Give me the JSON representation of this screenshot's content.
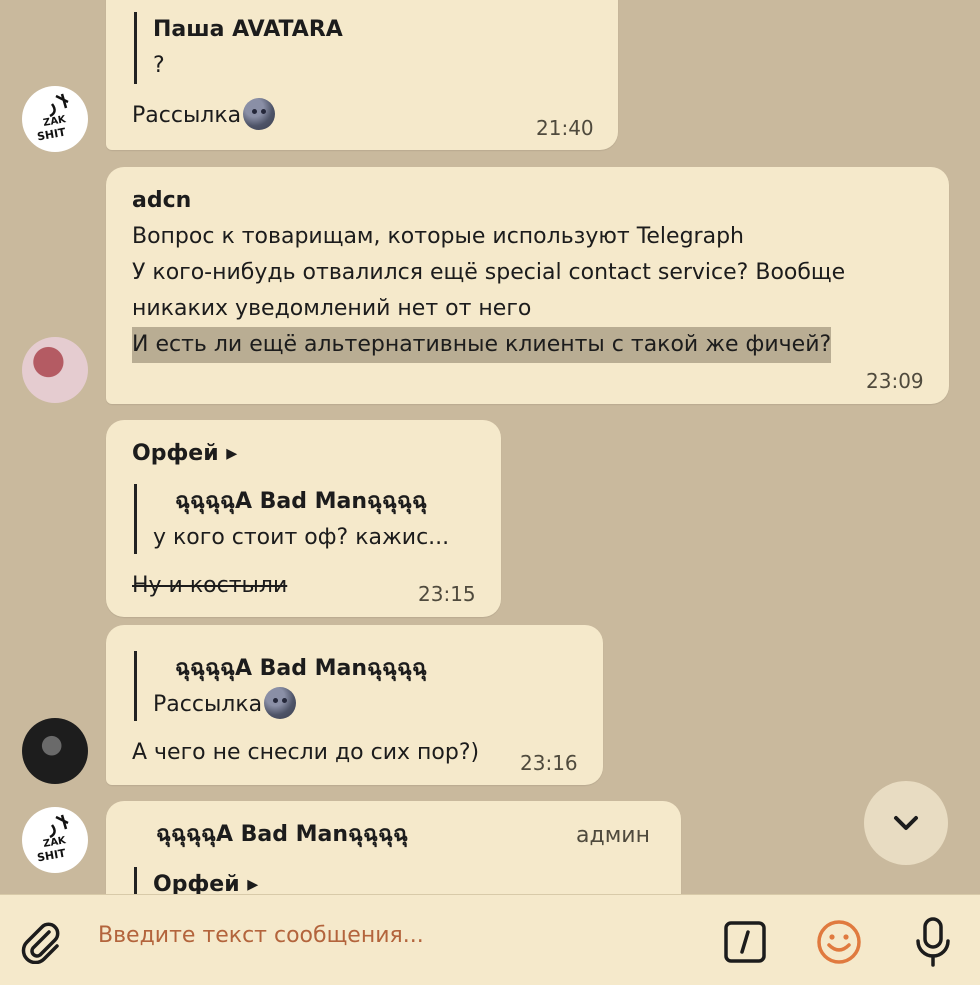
{
  "messages": [
    {
      "quote": {
        "name": "Паша AVATARA",
        "text": "?"
      },
      "text": "Рассылка",
      "emoji": "new-moon-face-emoji",
      "time": "21:40"
    },
    {
      "sender": "adcn",
      "lines": [
        "Вопрос к товарищам, которые используют Telegraph",
        "У кого-нибудь отвалился ещё special contact service? Вообще",
        "никаких уведомлений нет от него",
        "И есть ли ещё альтернативные клиенты с такой же фичей?"
      ],
      "time": "23:09"
    },
    {
      "sender": "Орфей ▸",
      "quote": {
        "name": "ฉุฉุฉุฉุA Bad Manฉุฉุฉุฉุ",
        "text": "у кого стоит оф?  кажис..."
      },
      "text": "Ну и костыли",
      "time": "23:15"
    },
    {
      "quote": {
        "name": "ฉุฉุฉุฉุA Bad Manฉุฉุฉุฉุ",
        "text": "Рассылка"
      },
      "text": "А чего не снесли до сих пор?)",
      "time": "23:16"
    },
    {
      "sender": "ฉุฉุฉุฉุA Bad Manฉุฉุฉุฉุ",
      "badge": "админ",
      "quote": {
        "name": "Орфей ▸"
      }
    }
  ],
  "composer": {
    "placeholder": "Введите текст сообщения..."
  },
  "colors": {
    "background": "#c9b99d",
    "bubble": "#f5e9cb",
    "placeholder": "#b3643c",
    "emoji_accent": "#e07a3f"
  },
  "icons": [
    "attach-icon",
    "commands-icon",
    "emoji-icon",
    "microphone-icon",
    "scroll-down-icon"
  ]
}
